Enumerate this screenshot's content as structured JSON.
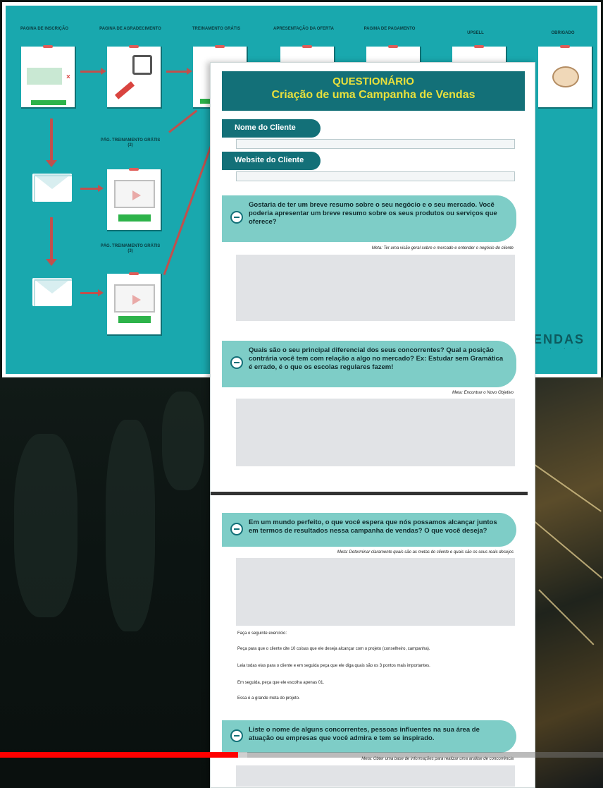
{
  "flowchart": {
    "nodes": [
      {
        "label": "PAGINA DE INSCRIÇÃO"
      },
      {
        "label": "PAGINA DE AGRADECIMENTO"
      },
      {
        "label": "TREINAMENTO GRÁTIS"
      },
      {
        "label": "APRESENTAÇÃO DA OFERTA"
      },
      {
        "label": "PAGINA DE PAGAMENTO"
      },
      {
        "label": "UPSELL"
      },
      {
        "label": "OBRIGADO"
      },
      {
        "label": "PÁG. TREINAMENTO GRÁTIS (2)"
      },
      {
        "label": "PÁG. TREINAMENTO GRÁTIS (3)"
      }
    ],
    "brand": "VENDAS"
  },
  "document": {
    "title": "QUESTIONÁRIO",
    "subtitle": "Criação de uma Campanha de Vendas",
    "fields": [
      {
        "label": "Nome do Cliente"
      },
      {
        "label": "Website do Cliente"
      }
    ],
    "questions": [
      {
        "text": "Gostaria de ter um breve resumo sobre o seu negócio e o seu mercado. Você poderia apresentar um breve resumo sobre os seus produtos ou serviços que oferece?",
        "note": "Meta: Ter uma visão geral sobre o mercado e entender o negócio do cliente"
      },
      {
        "text": "Quais são o seu principal diferencial dos seus concorrentes? Qual a posição contrária você tem com relação a algo no mercado? Ex: Estudar sem Gramática é errado, é o que os escolas regulares fazem!",
        "note": "Meta: Encontrar o Novo Objetivo"
      },
      {
        "text": "Em um mundo perfeito, o que você espera que nós possamos alcançar juntos em termos de resultados nessa campanha de vendas? O que você deseja?",
        "note": "Meta: Determinar claramente quais são as metas do cliente e quais são os seus reais desejos"
      },
      {
        "text": "Liste o nome de alguns concorrentes, pessoas influentes na sua área de atuação ou empresas que você admira e tem se inspirado.",
        "note": "Meta: Obter uma base de informações para realizar uma análise de concorrência"
      }
    ],
    "instructions": [
      "Faça o seguinte exercício:",
      "Peça para que o cliente cite 10 coisas que ele deseja alcançar com o projeto (conselheiro, campanha).",
      "Leia todas elas para o cliente e em seguida peça que ele diga quais são os 3 pontos mais importantes.",
      "Em seguida, peça que ele escolha apenas 01.",
      "Essa é a grande meta do projeto."
    ]
  },
  "video": {
    "progress": 0.395,
    "buffered": 0.41,
    "progress_color": "#ff0000"
  },
  "colors": {
    "teal_slide": "#19a8ae",
    "doc_header": "#137078",
    "question_bg": "#7ecdc7",
    "title_yellow": "#e9e03b"
  }
}
